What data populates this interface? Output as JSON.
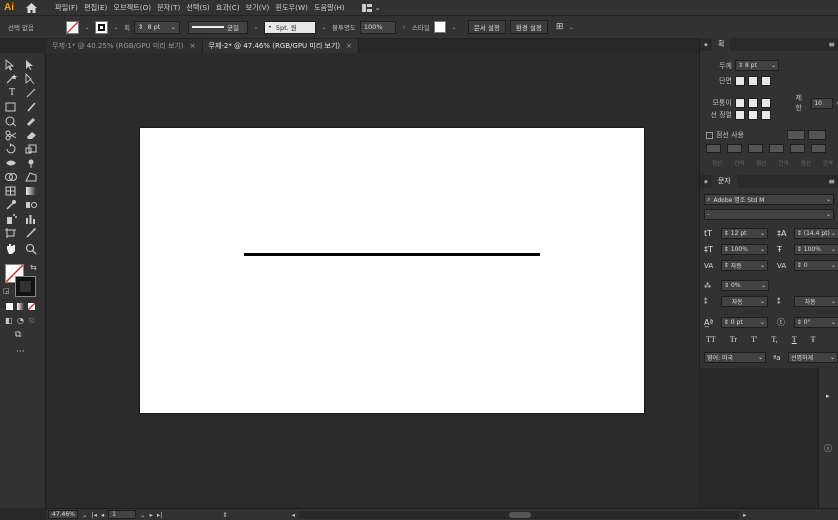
{
  "app": {
    "logo": "Ai"
  },
  "menu": [
    "파일(F)",
    "편집(E)",
    "오브젝트(O)",
    "문자(T)",
    "선택(S)",
    "효과(C)",
    "보기(V)",
    "윈도우(W)",
    "도움말(H)"
  ],
  "control": {
    "no_selection": "선택 없음",
    "stroke_label": "획",
    "stroke_value": "8 pt",
    "profile_label": "균일",
    "brush_label": "5pt. 원",
    "opacity_label": "불투명도",
    "opacity_value": "100%",
    "style_label": "스타일",
    "doc_setup": "문서 설정",
    "prefs": "환경 설정"
  },
  "tabs": [
    {
      "label": "무제-1* @ 40.25% (RGB/GPU 미리 보기)",
      "active": false
    },
    {
      "label": "무제-2* @ 47.46% (RGB/GPU 미리 보기)",
      "active": true
    }
  ],
  "status": {
    "zoom": "47.46%",
    "artboard": "1"
  },
  "stroke_panel": {
    "title": "획",
    "weight_label": "두께",
    "weight_value": "8 pt",
    "cap_label": "단면",
    "corner_label": "모퉁이",
    "limit_label": "제한",
    "limit_value": "10",
    "align_label": "선 정렬",
    "dashed_label": "점선 사용",
    "dash_fields": [
      "점선",
      "간격",
      "점선",
      "간격",
      "점선",
      "간격"
    ]
  },
  "char_panel": {
    "title": "문자",
    "font_family": "Adobe 명조 Std M",
    "font_style": "-",
    "size": "12 pt",
    "leading": "(14.4 pt)",
    "vscale": "100%",
    "hscale": "100%",
    "kerning": "자동",
    "tracking": "0",
    "tsume": "0%",
    "aki_left": "자동",
    "aki_right": "자동",
    "baseline": "0 pt",
    "rotation": "0°",
    "language": "영어: 미국",
    "antialias": "선명하게",
    "tt_buttons": [
      "TT",
      "Tr",
      "T'",
      "T,",
      "T",
      "Ŧ"
    ]
  },
  "colors": {
    "accent": "#ff9a00",
    "bg": "#282828",
    "panel": "#323232"
  }
}
